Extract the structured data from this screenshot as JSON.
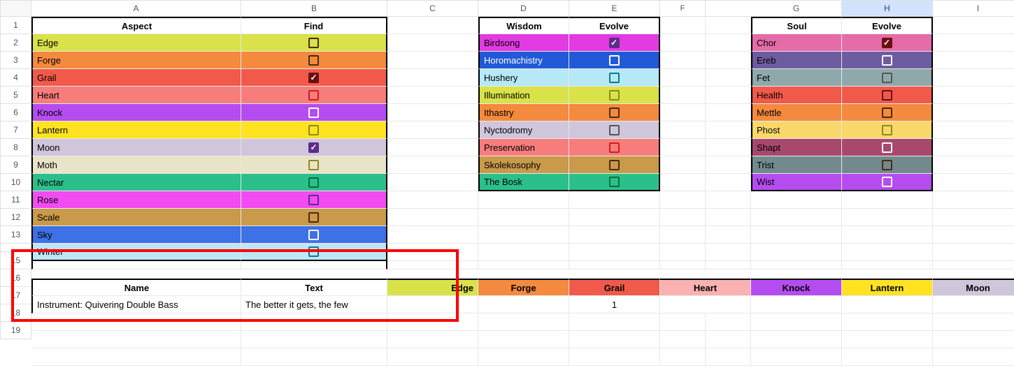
{
  "columns": [
    "A",
    "B",
    "C",
    "D",
    "E",
    "F",
    "G",
    "H",
    "I"
  ],
  "selected_column": "H",
  "rows": [
    1,
    2,
    3,
    4,
    5,
    6,
    7,
    8,
    9,
    10,
    11,
    12,
    13,
    15,
    16,
    17,
    18,
    19
  ],
  "aspect": {
    "header": {
      "a": "Aspect",
      "b": "Find"
    },
    "rows": [
      {
        "name": "Edge",
        "color": "c-edge",
        "checked": false,
        "chk": "chk-dark"
      },
      {
        "name": "Forge",
        "color": "c-forge",
        "checked": false,
        "chk": "chk-dark"
      },
      {
        "name": "Grail",
        "color": "c-grail",
        "checked": true,
        "chk": "chk-darkred chk-filled"
      },
      {
        "name": "Heart",
        "color": "c-heart",
        "checked": false,
        "chk": "chk-red"
      },
      {
        "name": "Knock",
        "color": "c-knock",
        "checked": false,
        "chk": "chk-white"
      },
      {
        "name": "Lantern",
        "color": "c-lantern",
        "checked": false,
        "chk": "chk-olive"
      },
      {
        "name": "Moon",
        "color": "c-moon",
        "checked": true,
        "chk": "chk-purple chk-filled"
      },
      {
        "name": "Moth",
        "color": "c-moth",
        "checked": false,
        "chk": "chk-olive"
      },
      {
        "name": "Nectar",
        "color": "c-nectar",
        "checked": false,
        "chk": "chk-green"
      },
      {
        "name": "Rose",
        "color": "c-rose",
        "checked": false,
        "chk": "chk-purple"
      },
      {
        "name": "Scale",
        "color": "c-scale",
        "checked": false,
        "chk": "chk-dark"
      },
      {
        "name": "Sky",
        "color": "c-sky",
        "checked": false,
        "chk": "chk-white"
      },
      {
        "name": "Winter",
        "color": "c-winter",
        "checked": false,
        "chk": "chk-teal",
        "clipped": true
      }
    ]
  },
  "wisdom": {
    "header": {
      "a": "Wisdom",
      "b": "Evolve"
    },
    "rows": [
      {
        "name": "Birdsong",
        "color": "c-birdsong",
        "checked": true,
        "chk": "chk-purple chk-filled"
      },
      {
        "name": "Horomachistry",
        "color": "c-horomach",
        "checked": false,
        "chk": "chk-white"
      },
      {
        "name": "Hushery",
        "color": "c-hushery",
        "checked": false,
        "chk": "chk-teal"
      },
      {
        "name": "Illumination",
        "color": "c-illum",
        "checked": false,
        "chk": "chk-olive"
      },
      {
        "name": "Ithastry",
        "color": "c-ithas",
        "checked": false,
        "chk": "chk-dark"
      },
      {
        "name": "Nyctodromy",
        "color": "c-nyct",
        "checked": false,
        "chk": "chk-gray"
      },
      {
        "name": "Preservation",
        "color": "c-pres",
        "checked": false,
        "chk": "chk-red"
      },
      {
        "name": "Skolekosophy",
        "color": "c-skol",
        "checked": false,
        "chk": "chk-dark"
      },
      {
        "name": "The Bosk",
        "color": "c-bosk",
        "checked": false,
        "chk": "chk-green"
      }
    ]
  },
  "soul": {
    "header": {
      "a": "Soul",
      "b": "Evolve"
    },
    "rows": [
      {
        "name": "Chor",
        "color": "c-chor",
        "checked": true,
        "chk": "chk-darkred chk-filled"
      },
      {
        "name": "Ereb",
        "color": "c-ereb",
        "checked": false,
        "chk": "chk-white"
      },
      {
        "name": "Fet",
        "color": "c-fet",
        "checked": false,
        "chk": "chk-gray"
      },
      {
        "name": "Health",
        "color": "c-health",
        "checked": false,
        "chk": "chk-darkred"
      },
      {
        "name": "Mettle",
        "color": "c-mettle",
        "checked": false,
        "chk": "chk-dark"
      },
      {
        "name": "Phost",
        "color": "c-phost",
        "checked": false,
        "chk": "chk-olive"
      },
      {
        "name": "Shapt",
        "color": "c-shapt",
        "checked": false,
        "chk": "chk-white"
      },
      {
        "name": "Trist",
        "color": "c-trist",
        "checked": false,
        "chk": "chk-dark"
      },
      {
        "name": "Wist",
        "color": "c-wist",
        "checked": false,
        "chk": "chk-white"
      }
    ]
  },
  "result": {
    "headers": {
      "name": "Name",
      "text": "Text",
      "edge": "Edge",
      "forge": "Forge",
      "grail": "Grail",
      "heart": "Heart",
      "knock": "Knock",
      "lantern": "Lantern",
      "moon": "Moon"
    },
    "row": {
      "name": "Instrument: Quivering Double Bass",
      "text": "The better it gets, the few",
      "grail": "1"
    }
  }
}
